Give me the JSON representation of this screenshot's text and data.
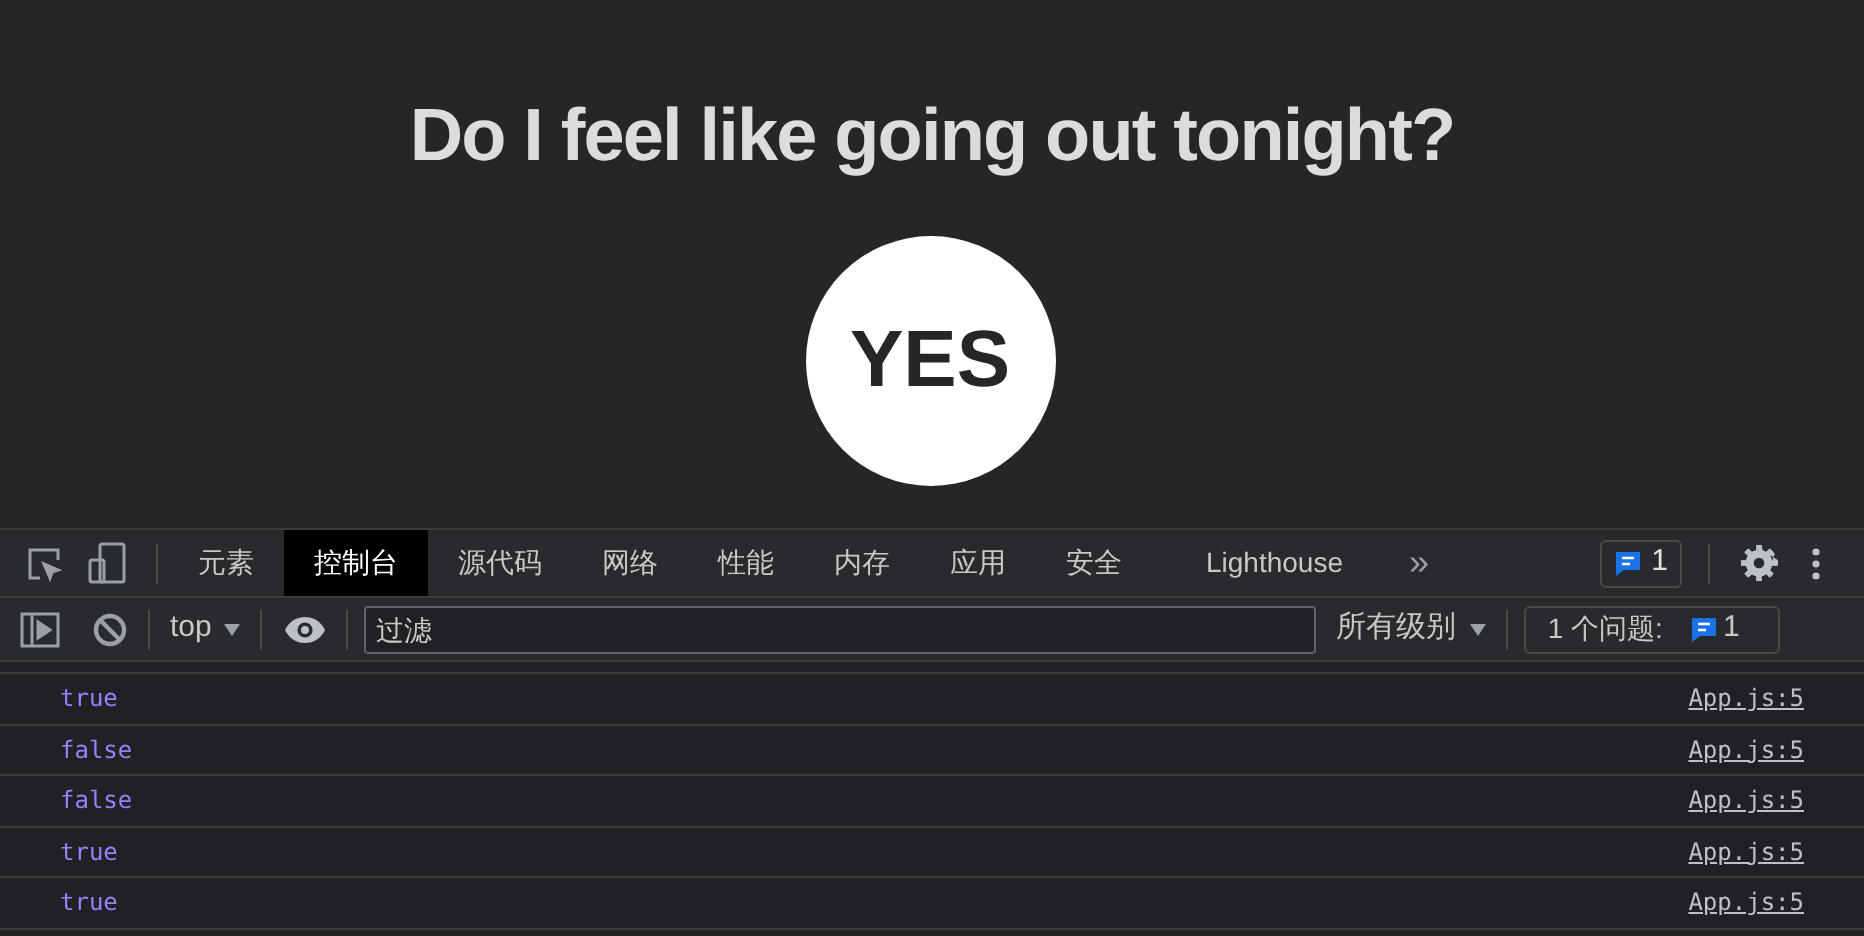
{
  "page": {
    "heading": "Do I feel like going out tonight?",
    "answer_button": "YES"
  },
  "devtools": {
    "tabs": [
      {
        "label": "元素",
        "selected": false
      },
      {
        "label": "控制台",
        "selected": true
      },
      {
        "label": "源代码",
        "selected": false
      },
      {
        "label": "网络",
        "selected": false
      },
      {
        "label": "性能",
        "selected": false
      },
      {
        "label": "内存",
        "selected": false
      },
      {
        "label": "应用",
        "selected": false
      },
      {
        "label": "安全",
        "selected": false
      },
      {
        "label": "Lighthouse",
        "selected": false
      }
    ],
    "more_tabs": "»",
    "issues_badge": "1",
    "toolbar": {
      "context": "top",
      "filter": {
        "placeholder": "过滤"
      },
      "levels": "所有级别",
      "issues_label": "1 个问题:",
      "issues_count": "1"
    },
    "messages": [
      {
        "value": "true",
        "source": "App.js:5"
      },
      {
        "value": "false",
        "source": "App.js:5"
      },
      {
        "value": "false",
        "source": "App.js:5"
      },
      {
        "value": "true",
        "source": "App.js:5"
      },
      {
        "value": "true",
        "source": "App.js:5"
      }
    ]
  }
}
